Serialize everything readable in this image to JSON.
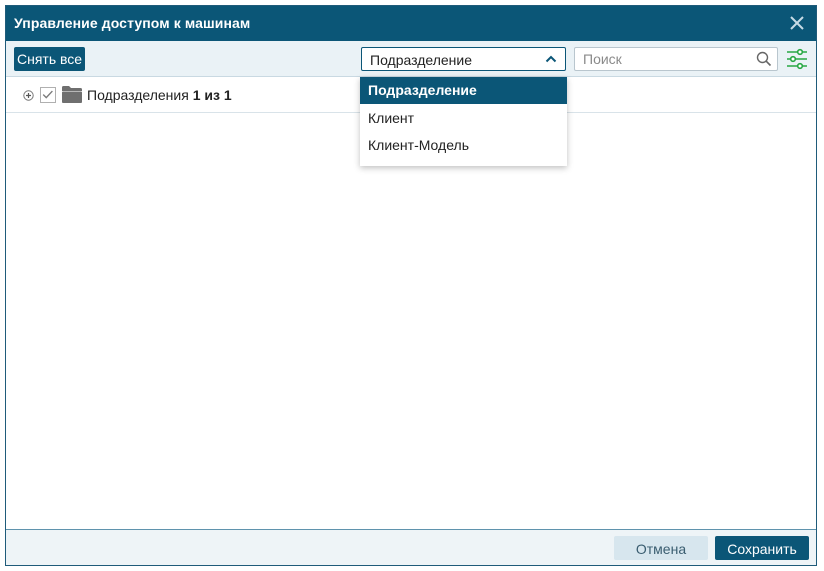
{
  "dialog": {
    "title": "Управление доступом к машинам"
  },
  "toolbar": {
    "clear_all_label": "Снять все",
    "group_by": {
      "selected": "Подразделение",
      "options": [
        "Подразделение",
        "Клиент",
        "Клиент-Модель"
      ]
    },
    "search": {
      "placeholder": "Поиск",
      "value": ""
    }
  },
  "tree": {
    "rows": [
      {
        "label": "Подразделения",
        "count": "1 из 1",
        "checked": true
      }
    ]
  },
  "footer": {
    "cancel_label": "Отмена",
    "save_label": "Сохранить"
  },
  "icons": {
    "close": "close-icon",
    "chevron": "chevron-up-icon",
    "search": "search-icon",
    "filter": "filter-settings-icon",
    "expand": "expand-plus-icon",
    "checkbox": "checkmark-icon",
    "folder": "folder-icon"
  },
  "colors": {
    "primary": "#0b5677",
    "filter_icon": "#27a844",
    "toolbar_bg": "#eaf2f6"
  }
}
